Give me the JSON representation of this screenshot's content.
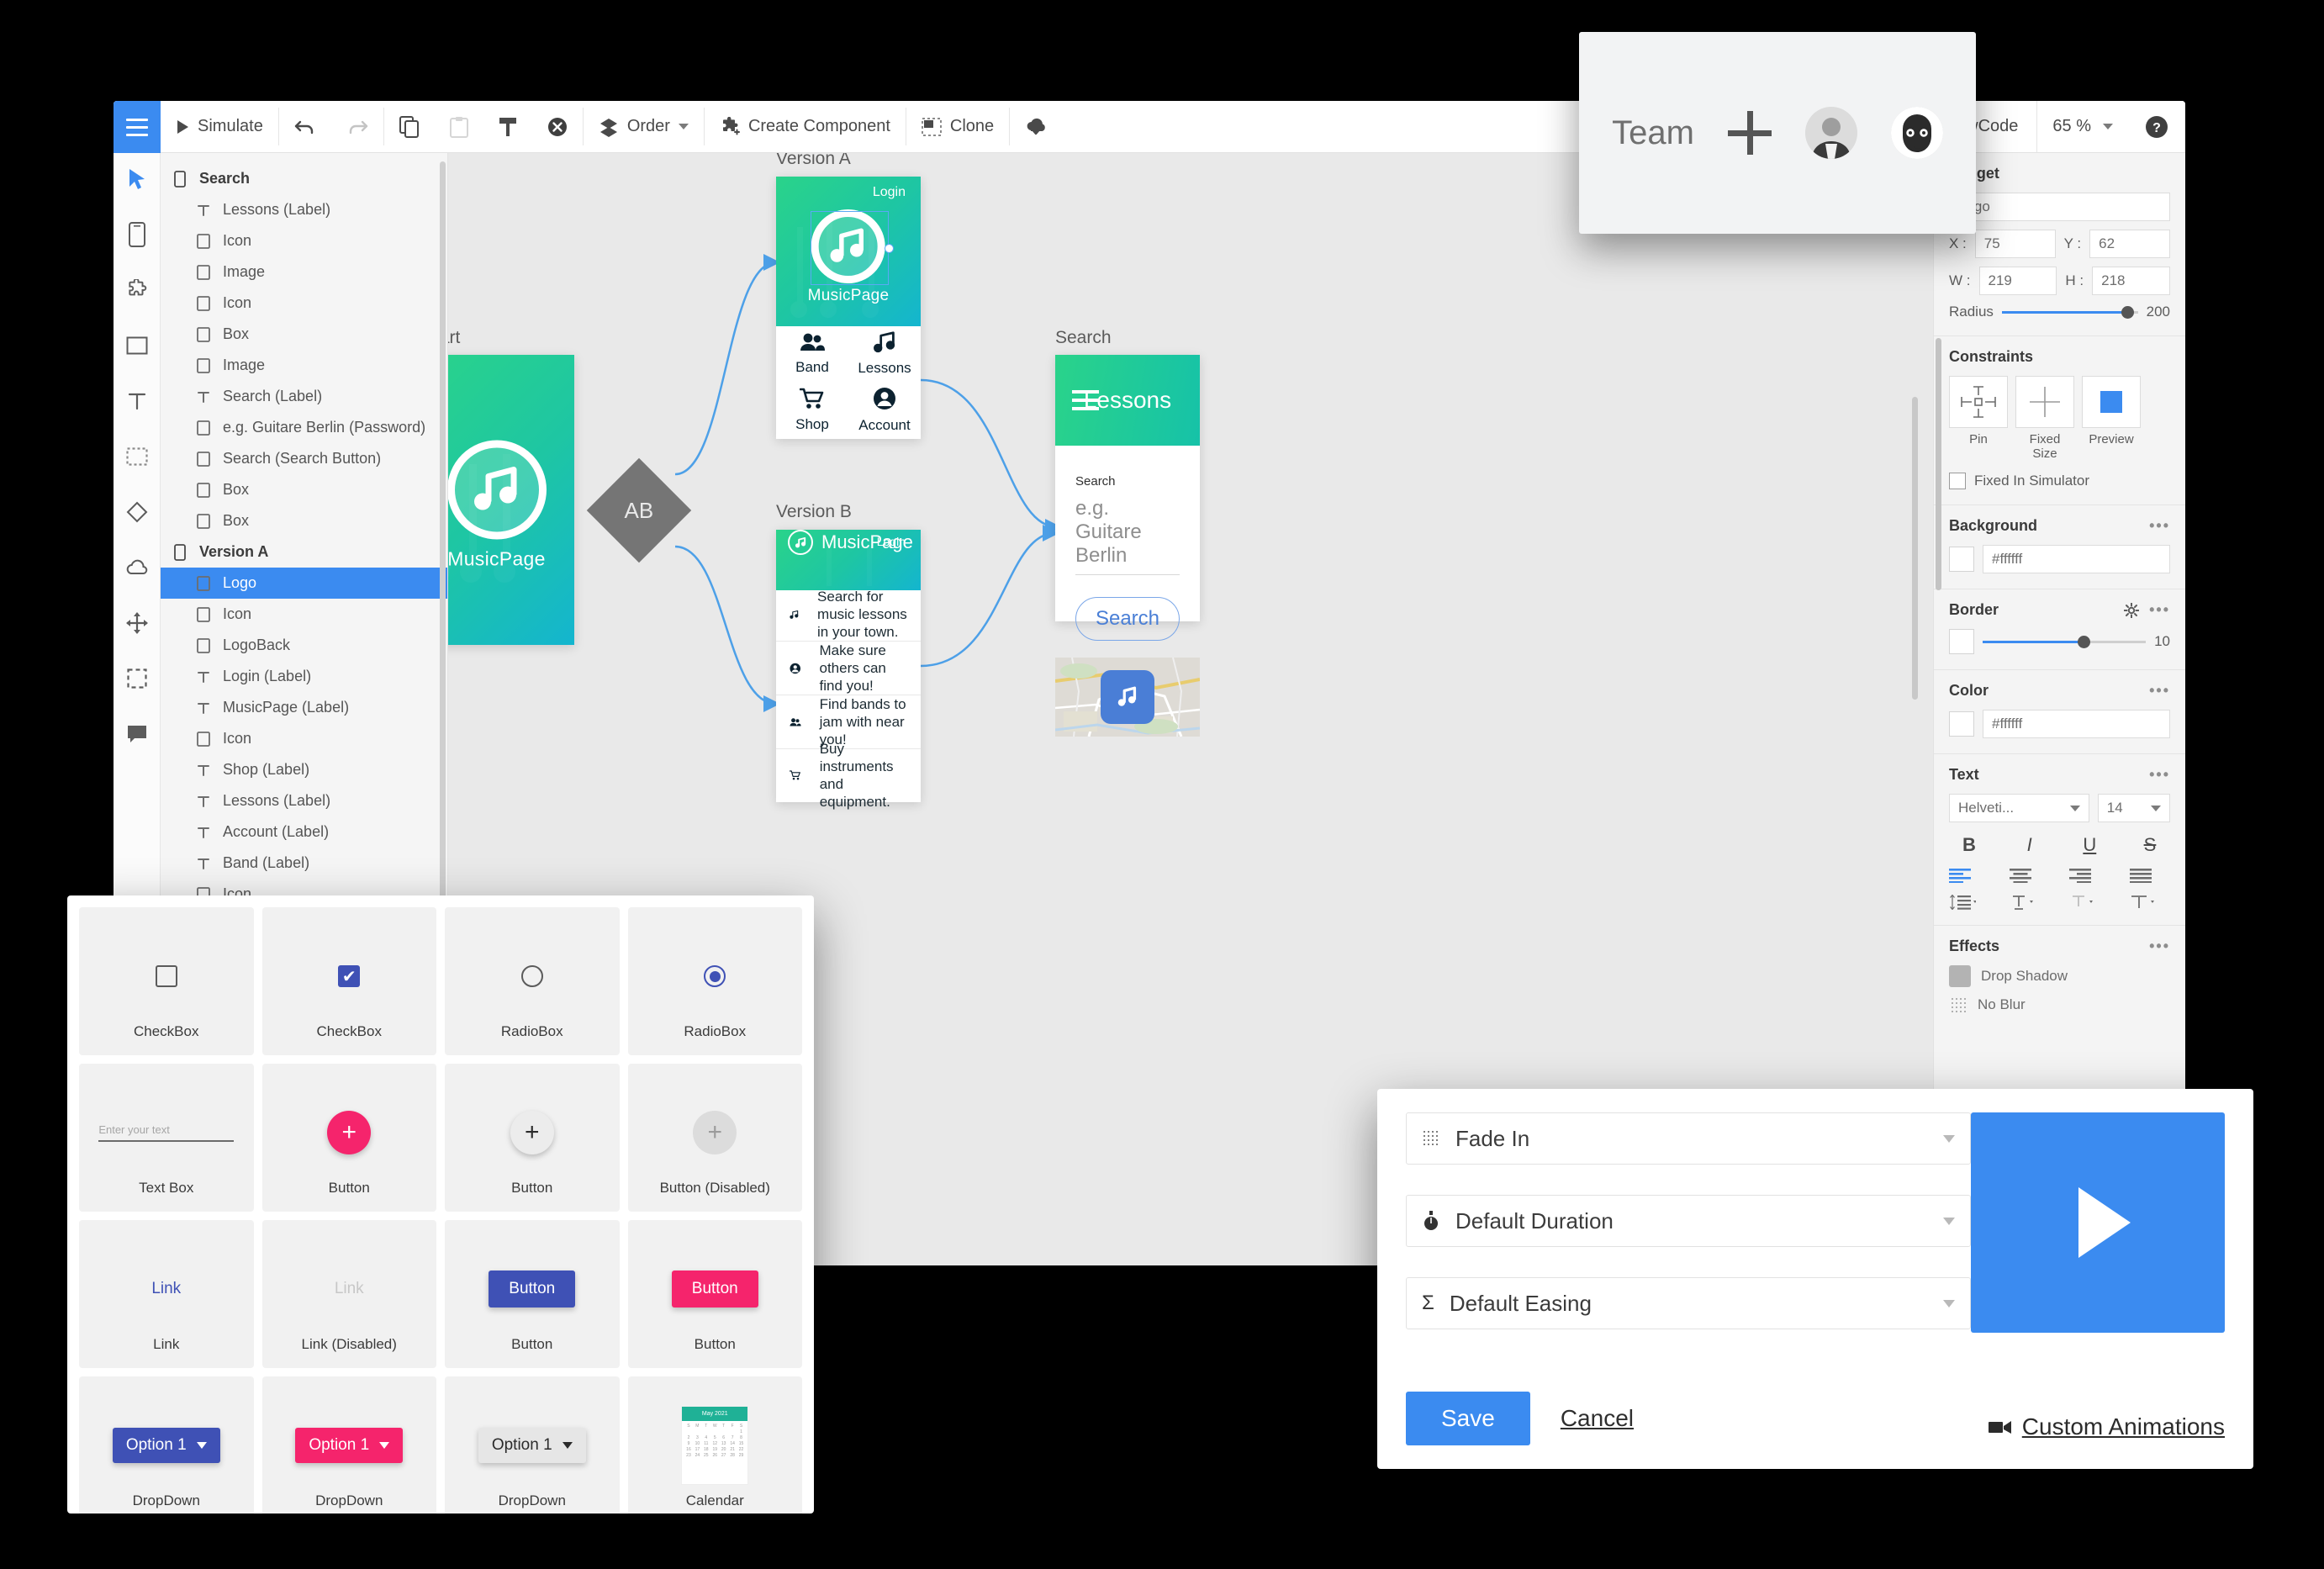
{
  "toolbar": {
    "burger_label": "menu",
    "simulate_label": "Simulate",
    "undo_label": "undo",
    "redo_label": "redo",
    "copy_label": "copy",
    "paste_label": "paste",
    "format_label": "format-painter",
    "clear_label": "clear-format",
    "order_label": "Order",
    "create_component_label": "Create Component",
    "clone_label": "Clone",
    "download_label": "download",
    "showcode_label": "ShowCode",
    "zoom_value": "65 %",
    "help_label": "?"
  },
  "rail": {
    "items": [
      {
        "name": "cursor-tool"
      },
      {
        "name": "device-tool"
      },
      {
        "name": "component-tool"
      },
      {
        "name": "rectangle-tool"
      },
      {
        "name": "text-tool"
      },
      {
        "name": "selection-tool"
      },
      {
        "name": "diamond-tool"
      },
      {
        "name": "cloud-tool"
      },
      {
        "name": "move-tool"
      },
      {
        "name": "marquee-tool"
      },
      {
        "name": "comment-tool"
      }
    ]
  },
  "layers": [
    {
      "label": "Search",
      "type": "screen",
      "level": 0,
      "selected": false
    },
    {
      "label": "Lessons (Label)",
      "type": "text",
      "level": 1,
      "selected": false
    },
    {
      "label": "Icon",
      "type": "box",
      "level": 1,
      "selected": false
    },
    {
      "label": "Image",
      "type": "box",
      "level": 1,
      "selected": false
    },
    {
      "label": "Icon",
      "type": "box",
      "level": 1,
      "selected": false
    },
    {
      "label": "Box",
      "type": "box",
      "level": 1,
      "selected": false
    },
    {
      "label": "Image",
      "type": "box",
      "level": 1,
      "selected": false
    },
    {
      "label": "Search (Label)",
      "type": "text",
      "level": 1,
      "selected": false
    },
    {
      "label": "e.g. Guitare Berlin (Password)",
      "type": "box",
      "level": 1,
      "selected": false
    },
    {
      "label": "Search (Search Button)",
      "type": "box",
      "level": 1,
      "selected": false
    },
    {
      "label": "Box",
      "type": "box",
      "level": 1,
      "selected": false
    },
    {
      "label": "Box",
      "type": "box",
      "level": 1,
      "selected": false
    },
    {
      "label": "Version A",
      "type": "screen",
      "level": 0,
      "selected": false
    },
    {
      "label": "Logo",
      "type": "box",
      "level": 1,
      "selected": true
    },
    {
      "label": "Icon",
      "type": "box",
      "level": 1,
      "selected": false
    },
    {
      "label": "LogoBack",
      "type": "box",
      "level": 1,
      "selected": false
    },
    {
      "label": "Login (Label)",
      "type": "text",
      "level": 1,
      "selected": false
    },
    {
      "label": "MusicPage (Label)",
      "type": "text",
      "level": 1,
      "selected": false
    },
    {
      "label": "Icon",
      "type": "box",
      "level": 1,
      "selected": false
    },
    {
      "label": "Shop (Label)",
      "type": "text",
      "level": 1,
      "selected": false
    },
    {
      "label": "Lessons (Label)",
      "type": "text",
      "level": 1,
      "selected": false
    },
    {
      "label": "Account (Label)",
      "type": "text",
      "level": 1,
      "selected": false
    },
    {
      "label": "Band (Label)",
      "type": "text",
      "level": 1,
      "selected": false
    },
    {
      "label": "Icon",
      "type": "box",
      "level": 1,
      "selected": false
    }
  ],
  "canvas": {
    "start": {
      "frame_label": "Start",
      "title": "MusicPage"
    },
    "ab_node": {
      "label": "AB"
    },
    "version_a": {
      "frame_label": "Version A",
      "login": "Login",
      "title": "MusicPage",
      "tiles": [
        {
          "label": "Band",
          "icon": "people-icon"
        },
        {
          "label": "Lessons",
          "icon": "music-note-icon"
        },
        {
          "label": "Shop",
          "icon": "cart-icon"
        },
        {
          "label": "Account",
          "icon": "account-icon"
        }
      ]
    },
    "version_b": {
      "frame_label": "Version B",
      "login": "Login",
      "title": "MusicPage",
      "rows": [
        {
          "text": "Search for music lessons in your town.",
          "icon": "music-note-icon"
        },
        {
          "text": "Make sure others can find you!",
          "icon": "account-icon"
        },
        {
          "text": "Find bands to jam with near you!",
          "icon": "people-icon"
        },
        {
          "text": "Buy instruments and equipment.",
          "icon": "cart-icon"
        }
      ]
    },
    "search": {
      "frame_label": "Search",
      "title": "Lessons",
      "field_label": "Search",
      "field_placeholder": "e.g. Guitare Berlin",
      "button_label": "Search"
    }
  },
  "team_popup": {
    "title": "Team",
    "add_label": "+",
    "members": [
      {
        "name": "team-avatar-1"
      },
      {
        "name": "team-avatar-2"
      }
    ]
  },
  "palette": {
    "items": [
      {
        "caption": "CheckBox",
        "art": "checkbox-empty"
      },
      {
        "caption": "CheckBox",
        "art": "checkbox-checked"
      },
      {
        "caption": "RadioBox",
        "art": "radio-empty"
      },
      {
        "caption": "RadioBox",
        "art": "radio-checked"
      },
      {
        "caption": "Text Box",
        "art": "textbox",
        "placeholder": "Enter your text"
      },
      {
        "caption": "Button",
        "art": "fab-pink",
        "glyph": "+"
      },
      {
        "caption": "Button",
        "art": "fab-grey",
        "glyph": "+"
      },
      {
        "caption": "Button (Disabled)",
        "art": "fab-disabled",
        "glyph": "+"
      },
      {
        "caption": "Link",
        "art": "link",
        "text": "Link"
      },
      {
        "caption": "Link (Disabled)",
        "art": "link-disabled",
        "text": "Link"
      },
      {
        "caption": "Button",
        "art": "button-blue",
        "text": "Button"
      },
      {
        "caption": "Button",
        "art": "button-pink",
        "text": "Button"
      },
      {
        "caption": "DropDown",
        "art": "dropdown-blue",
        "text": "Option 1"
      },
      {
        "caption": "DropDown",
        "art": "dropdown-pink",
        "text": "Option 1"
      },
      {
        "caption": "DropDown",
        "art": "dropdown-grey",
        "text": "Option 1"
      },
      {
        "caption": "Calendar",
        "art": "calendar",
        "text": "May 2021"
      }
    ]
  },
  "anim_dialog": {
    "effect": "Fade In",
    "duration": "Default Duration",
    "easing": "Default Easing",
    "save_label": "Save",
    "cancel_label": "Cancel",
    "custom_label": "Custom Animations",
    "preview_label": "play"
  },
  "props": {
    "widget_title": "Widget",
    "name_value": "Logo",
    "x_label": "X :",
    "x_value": "75",
    "y_label": "Y :",
    "y_value": "62",
    "w_label": "W :",
    "w_value": "219",
    "h_label": "H :",
    "h_value": "218",
    "radius_label": "Radius",
    "radius_value": "200",
    "constraints_title": "Constraints",
    "pin_label": "Pin",
    "fixed_size_label": "Fixed Size",
    "preview_label": "Preview",
    "fixed_in_simulator_label": "Fixed In Simulator",
    "background_title": "Background",
    "background_value": "#ffffff",
    "border_title": "Border",
    "border_value": "10",
    "color_title": "Color",
    "color_value": "#ffffff",
    "text_title": "Text",
    "font_value": "Helveti...",
    "font_size_value": "14",
    "bold": "B",
    "italic": "I",
    "underline": "U",
    "strike": "S",
    "effects_title": "Effects",
    "drop_shadow_label": "Drop Shadow",
    "blur_label": "No Blur",
    "dots": "•••"
  },
  "colors": {
    "accent_blue": "#3b8bf0",
    "green_start": "#2ad38a",
    "cyan_end": "#14b5cf",
    "pink": "#f5246c",
    "indigo": "#3f51b5"
  }
}
